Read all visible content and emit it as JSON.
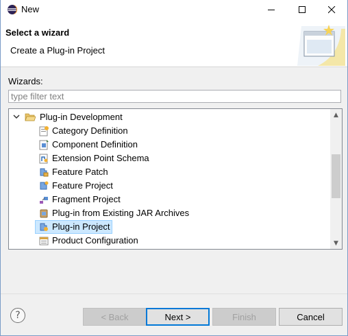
{
  "window": {
    "title": "New"
  },
  "header": {
    "title": "Select a wizard",
    "description": "Create a Plug-in Project"
  },
  "wizards_label": "Wizards:",
  "filter": {
    "placeholder": "type filter text",
    "value": ""
  },
  "tree": {
    "category": {
      "label": "Plug-in Development",
      "expanded": true,
      "icon": "folder-open-icon"
    },
    "items": [
      {
        "label": "Category Definition",
        "icon": "category-definition-icon"
      },
      {
        "label": "Component Definition",
        "icon": "component-definition-icon"
      },
      {
        "label": "Extension Point Schema",
        "icon": "extension-point-schema-icon"
      },
      {
        "label": "Feature Patch",
        "icon": "feature-patch-icon"
      },
      {
        "label": "Feature Project",
        "icon": "feature-project-icon"
      },
      {
        "label": "Fragment Project",
        "icon": "fragment-project-icon"
      },
      {
        "label": "Plug-in from Existing JAR Archives",
        "icon": "plugin-jar-icon"
      },
      {
        "label": "Plug-in Project",
        "icon": "plugin-project-icon",
        "selected": true
      },
      {
        "label": "Product Configuration",
        "icon": "product-configuration-icon"
      }
    ]
  },
  "buttons": {
    "back": "< Back",
    "next": "Next >",
    "finish": "Finish",
    "cancel": "Cancel"
  },
  "colors": {
    "selection": "#cce8ff",
    "default_button_border": "#0078d7"
  }
}
